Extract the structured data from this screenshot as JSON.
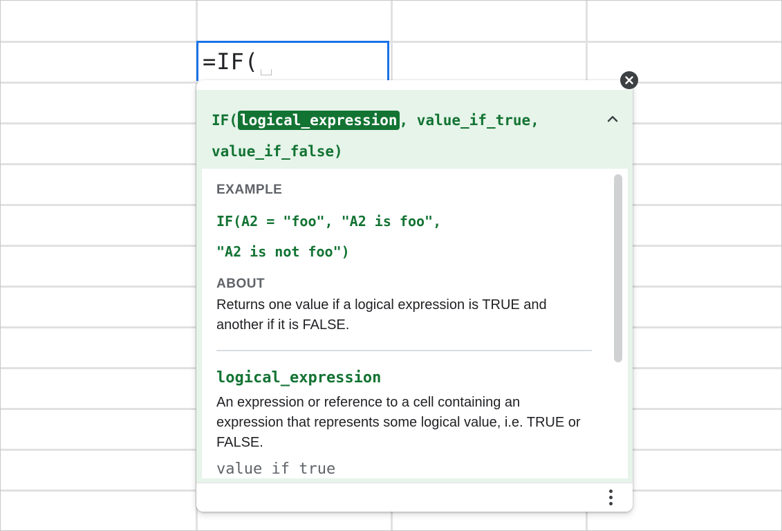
{
  "cell": {
    "input_text": "=IF("
  },
  "formula_help": {
    "signature_prefix": "IF(",
    "signature_active_param": "logical_expression",
    "signature_rest_line1": ", value_if_true,",
    "signature_line2": "value_if_false)",
    "example_label": "EXAMPLE",
    "example_line1": "IF(A2 = \"foo\", \"A2 is foo\",",
    "example_line2": "\"A2 is not foo\")",
    "about_label": "ABOUT",
    "about_text": "Returns one value if a logical expression is TRUE and another if it is FALSE.",
    "param_name": "logical_expression",
    "param_description": "An expression or reference to a cell containing an expression that represents some logical value, i.e. TRUE or FALSE.",
    "next_param_name": "value if true"
  },
  "icons": {
    "close": "close-icon",
    "collapse": "chevron-up-icon",
    "more": "more-vert-icon"
  },
  "colors": {
    "accent_green": "#137333",
    "selection_blue": "#1a73e8",
    "panel_bg": "#e6f4ea"
  }
}
